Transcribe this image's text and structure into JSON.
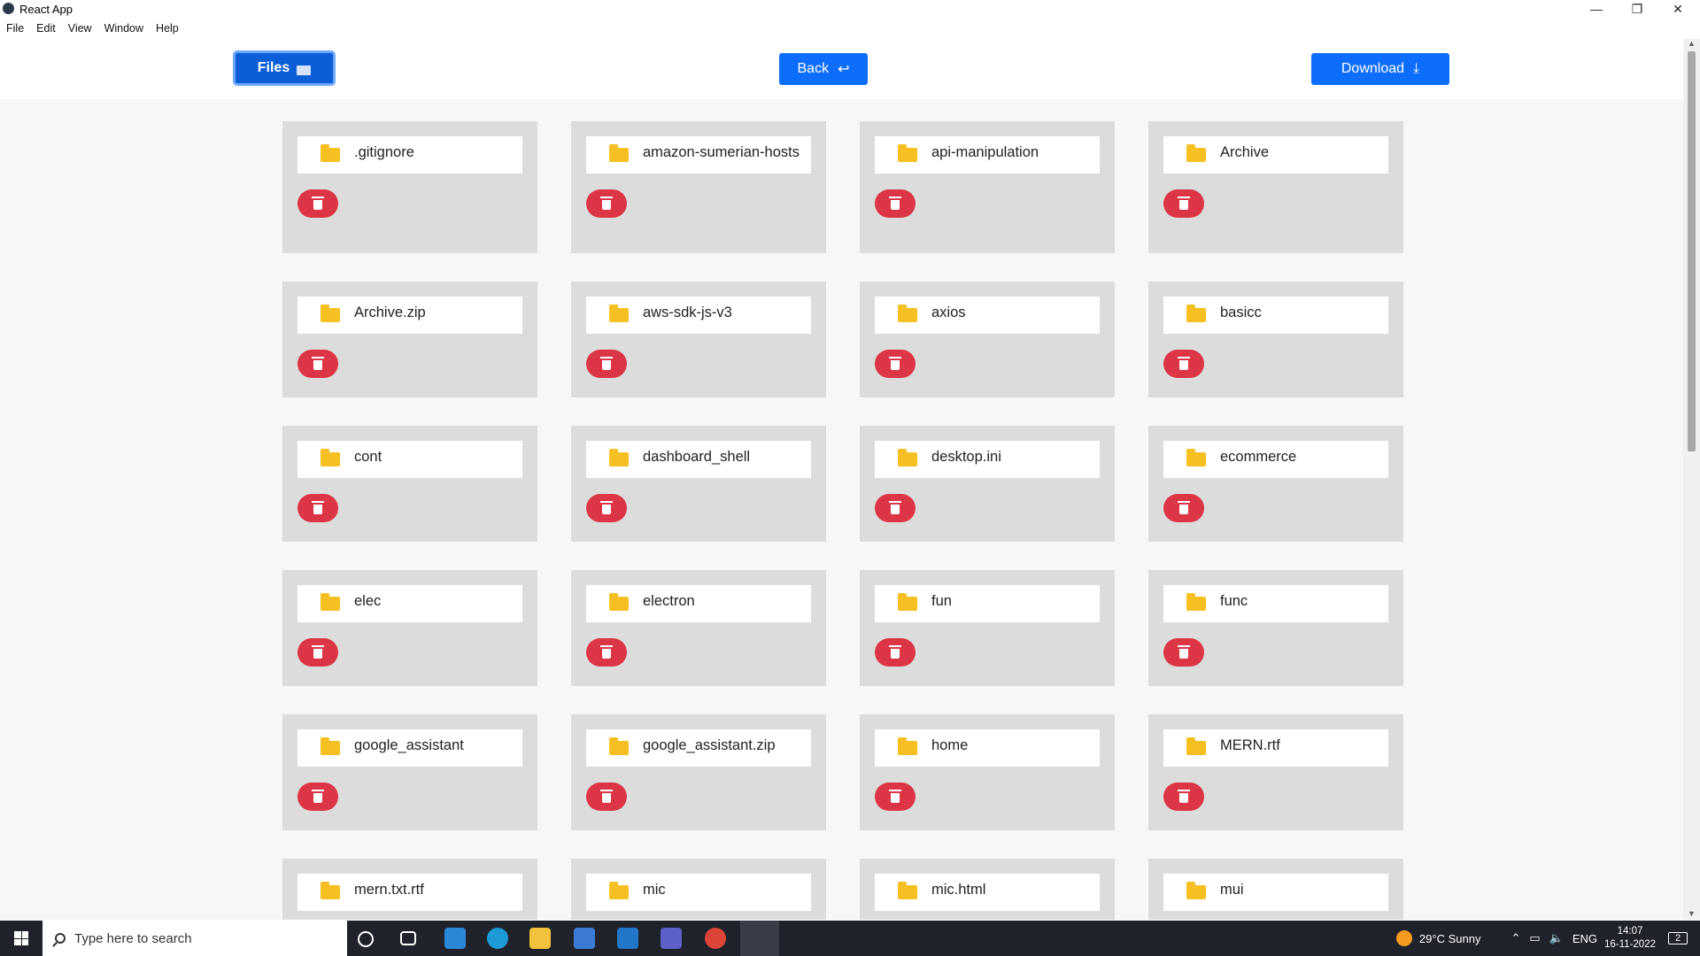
{
  "window": {
    "title": "React App",
    "minimize": "—",
    "restore": "❐",
    "close": "✕"
  },
  "menu": [
    "File",
    "Edit",
    "View",
    "Window",
    "Help"
  ],
  "toolbar": {
    "files_label": "Files",
    "back_label": "Back",
    "back_icon": "↩",
    "download_label": "Download",
    "download_icon": "⤓"
  },
  "files": [
    ".gitignore",
    "amazon-sumerian-hosts",
    "api-manipulation",
    "Archive",
    "Archive.zip",
    "aws-sdk-js-v3",
    "axios",
    "basicc",
    "cont",
    "dashboard_shell",
    "desktop.ini",
    "ecommerce",
    "elec",
    "electron",
    "fun",
    "func",
    "google_assistant",
    "google_assistant.zip",
    "home",
    "MERN.rtf",
    "mern.txt.rtf",
    "mic",
    "mic.html",
    "mui"
  ],
  "taskbar": {
    "search_placeholder": "Type here to search",
    "weather": "29°C  Sunny",
    "language": "ENG",
    "time": "14:07",
    "date": "16-11-2022",
    "notifications": "2"
  }
}
